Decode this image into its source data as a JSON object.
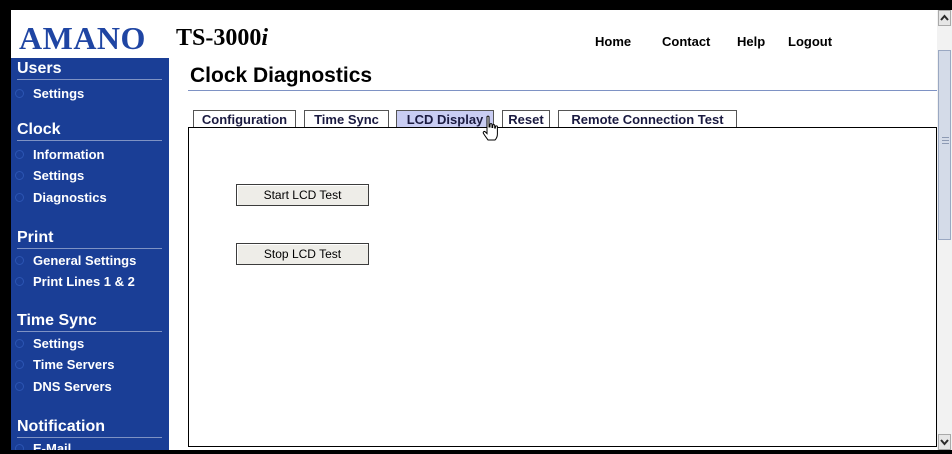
{
  "header": {
    "logo": "AMANO",
    "product_main": "TS-3000",
    "product_suffix": "i",
    "nav": [
      "Home",
      "Contact",
      "Help",
      "Logout"
    ]
  },
  "sidebar": {
    "sections": [
      {
        "title": "Users",
        "items": [
          "Settings"
        ]
      },
      {
        "title": "Clock",
        "items": [
          "Information",
          "Settings",
          "Diagnostics"
        ]
      },
      {
        "title": "Print",
        "items": [
          "General Settings",
          "Print Lines 1 & 2"
        ]
      },
      {
        "title": "Time Sync",
        "items": [
          "Settings",
          "Time Servers",
          "DNS Servers"
        ]
      },
      {
        "title": "Notification",
        "items": [
          "E-Mail"
        ]
      }
    ]
  },
  "main": {
    "title": "Clock Diagnostics",
    "tabs": [
      "Configuration",
      "Time Sync",
      "LCD Display",
      "Reset",
      "Remote Connection Test"
    ],
    "active_tab": "LCD Display",
    "buttons": {
      "start": "Start LCD Test",
      "stop": "Stop LCD Test"
    }
  },
  "colors": {
    "brand": "#1f45a3",
    "sidebar_bg": "#1a3e96",
    "active_tab": "#c9cdf3"
  },
  "icons": [
    "hand-pointer-cursor-icon",
    "scroll-up-arrow-icon",
    "scroll-down-arrow-icon"
  ]
}
